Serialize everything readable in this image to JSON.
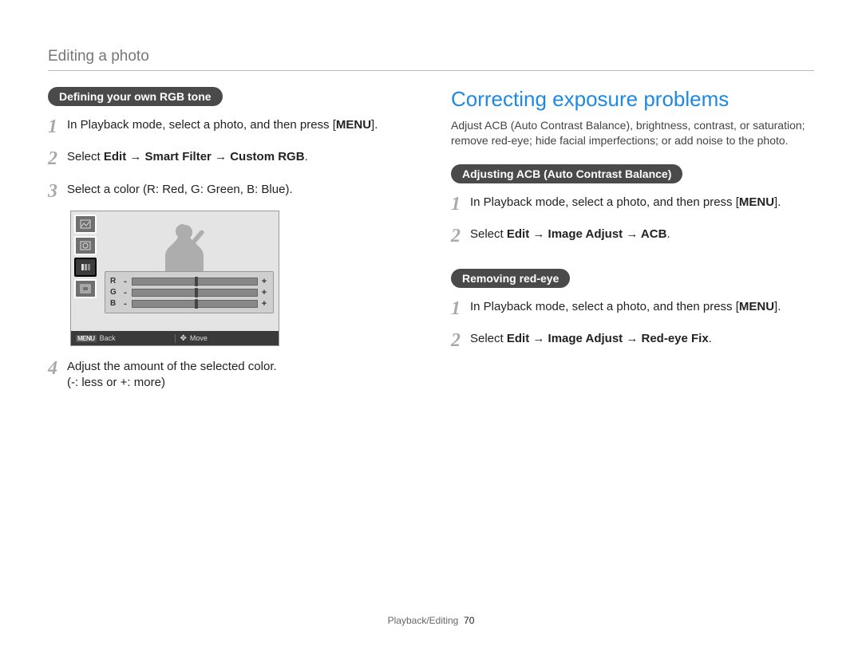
{
  "section_title": "Editing a photo",
  "left": {
    "pill": "Defining your own RGB tone",
    "steps": [
      {
        "num": "1",
        "pre": "In Playback mode, select a photo, and then press [",
        "bold": "MENU",
        "post": "]."
      },
      {
        "num": "2",
        "pre": "Select ",
        "bold": "Edit → Smart Filter → Custom RGB",
        "post": "."
      },
      {
        "num": "3",
        "pre": "Select a color (R: Red, G: Green, B: Blue).",
        "bold": "",
        "post": ""
      },
      {
        "num": "4",
        "pre": "Adjust the amount of the selected color.",
        "bold": "",
        "post": "",
        "sub": "(-: less or +: more)"
      }
    ],
    "diagram": {
      "sliders": [
        "R",
        "G",
        "B"
      ],
      "legend_back": "Back",
      "legend_move": "Move",
      "legend_menu_label": "MENU"
    }
  },
  "right": {
    "heading": "Correcting exposure problems",
    "intro": "Adjust ACB (Auto Contrast Balance), brightness, contrast, or saturation; remove red-eye; hide facial imperfections; or add noise to the photo.",
    "groups": [
      {
        "pill": "Adjusting ACB (Auto Contrast Balance)",
        "steps": [
          {
            "num": "1",
            "pre": "In Playback mode, select a photo, and then press [",
            "bold": "MENU",
            "post": "]."
          },
          {
            "num": "2",
            "pre": "Select ",
            "bold": "Edit → Image Adjust → ACB",
            "post": "."
          }
        ]
      },
      {
        "pill": "Removing red-eye",
        "steps": [
          {
            "num": "1",
            "pre": "In Playback mode, select a photo, and then press [",
            "bold": "MENU",
            "post": "]."
          },
          {
            "num": "2",
            "pre": "Select ",
            "bold": "Edit → Image Adjust → Red-eye Fix",
            "post": "."
          }
        ]
      }
    ]
  },
  "footer": {
    "section": "Playback/Editing",
    "page": "70"
  }
}
